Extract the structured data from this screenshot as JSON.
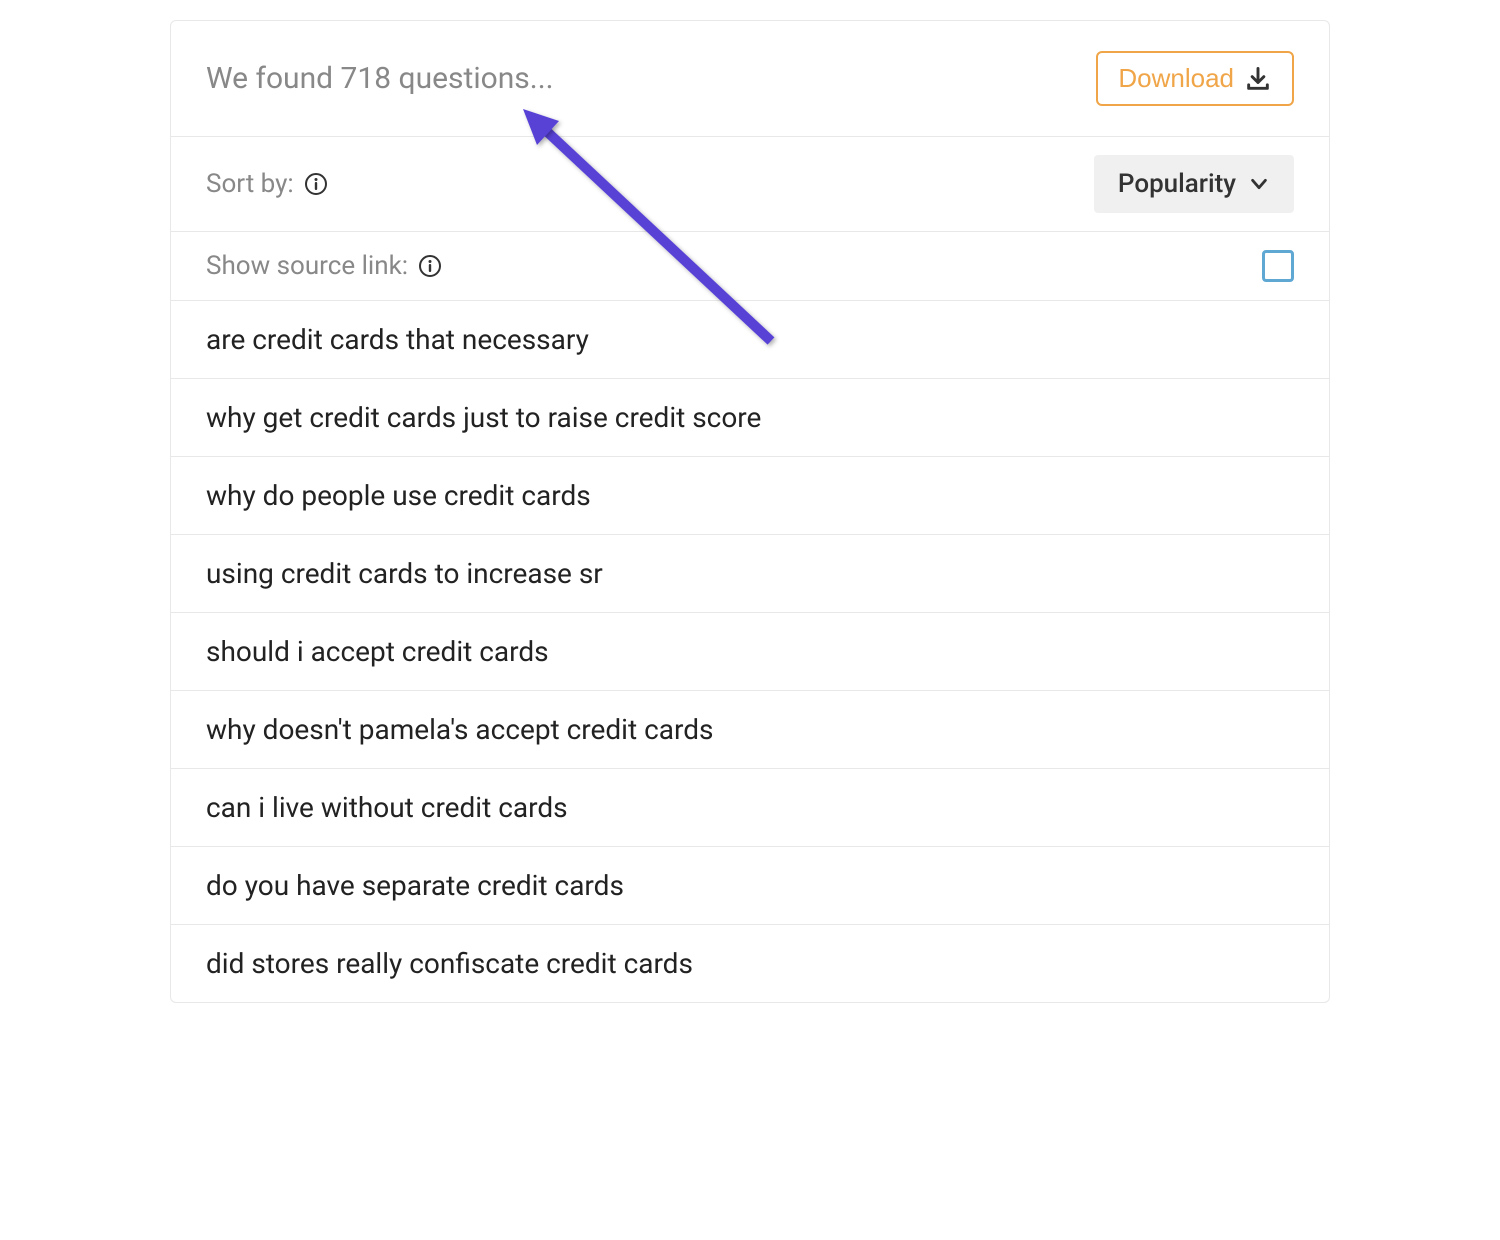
{
  "header": {
    "results_text": "We found 718 questions...",
    "download_label": "Download"
  },
  "controls": {
    "sort_label": "Sort by:",
    "sort_value": "Popularity",
    "source_link_label": "Show source link:"
  },
  "questions": [
    "are credit cards that necessary",
    "why get credit cards just to raise credit score",
    "why do people use credit cards",
    "using credit cards to increase sr",
    "should i accept credit cards",
    "why doesn't pamela's accept credit cards",
    "can i live without credit cards",
    "do you have separate credit cards",
    "did stores really confiscate credit cards"
  ]
}
